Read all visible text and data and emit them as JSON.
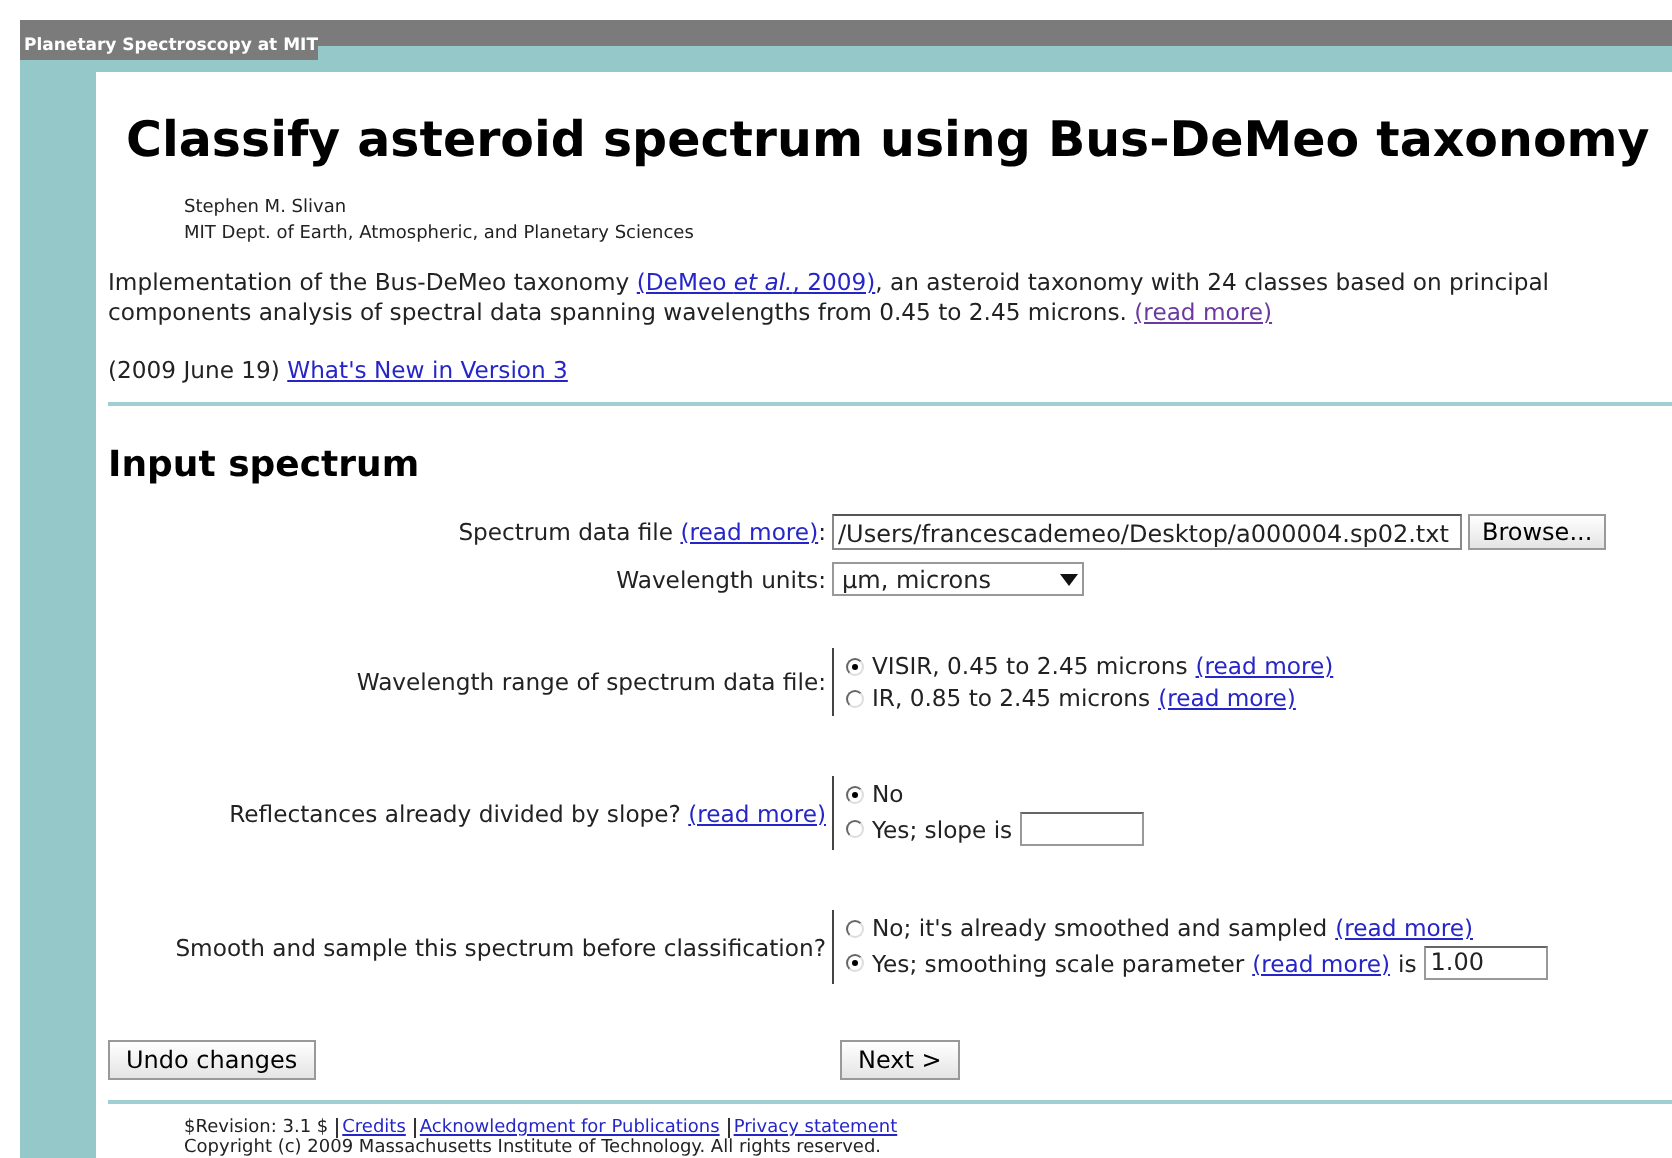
{
  "banner": {
    "title": "Planetary Spectroscopy at MIT"
  },
  "page": {
    "title": "Classify asteroid spectrum using Bus-DeMeo taxonomy",
    "author": "Stephen M. Slivan",
    "affiliation": "MIT Dept. of Earth, Atmospheric, and Planetary Sciences",
    "intro": [
      {
        "kind": "text",
        "text": "Implementation of the Bus-DeMeo taxonomy "
      },
      {
        "kind": "link",
        "text": "(DeMeo *et al.*, 2009)",
        "visited": false
      },
      {
        "kind": "text",
        "text": ", an asteroid taxonomy with 24 classes based on principal components analysis of spectral data spanning wavelengths from 0.45 to 2.45 microns. "
      },
      {
        "kind": "link",
        "text": "(read more)",
        "visited": true
      }
    ],
    "news": {
      "date": "(2009 June 19)",
      "link": "What's New in Version 3"
    }
  },
  "form": {
    "heading": "Input spectrum",
    "rows": [
      {
        "kind": "file",
        "label": "Spectrum data file",
        "link": "(read more)",
        "label_suffix": ":",
        "value": "/Users/francescademeo/Desktop/a000004.sp02.txt",
        "button": "Browse..."
      },
      {
        "kind": "select",
        "label": "Wavelength units:",
        "value": "µm, microns"
      },
      {
        "kind": "radio",
        "label": "Wavelength range of spectrum data file:",
        "options": [
          {
            "kind": "plain",
            "label": "VISIR, 0.45 to 2.45 microns",
            "link": "(read more)",
            "selected": true
          },
          {
            "kind": "plain",
            "label": "IR, 0.85 to 2.45 microns",
            "link": "(read more)",
            "selected": false
          }
        ]
      },
      {
        "kind": "radio",
        "label": "Reflectances already divided by slope?",
        "link": "(read more)",
        "options": [
          {
            "kind": "plain",
            "label": "No",
            "selected": true
          },
          {
            "kind": "with-field",
            "label": "Yes; slope is",
            "selected": false
          }
        ]
      },
      {
        "kind": "radio",
        "label": "Smooth and sample this spectrum before classification?",
        "options": [
          {
            "kind": "plain",
            "label": "No; it's already smoothed and sampled",
            "link": "(read more)",
            "selected": false
          },
          {
            "kind": "with-field",
            "label": "Yes; smoothing scale parameter",
            "link": "(read more)",
            "suffix": "is",
            "value": "1.00",
            "selected": true
          }
        ]
      }
    ],
    "buttons": [
      "Undo changes",
      "Next >"
    ]
  },
  "footer": {
    "revision": "$Revision: 3.1 $",
    "links": [
      "Credits",
      "Acknowledgment for Publications",
      "Privacy statement"
    ],
    "copyright": "Copyright (c) 2009 Massachusetts Institute of Technology. All rights reserved."
  }
}
